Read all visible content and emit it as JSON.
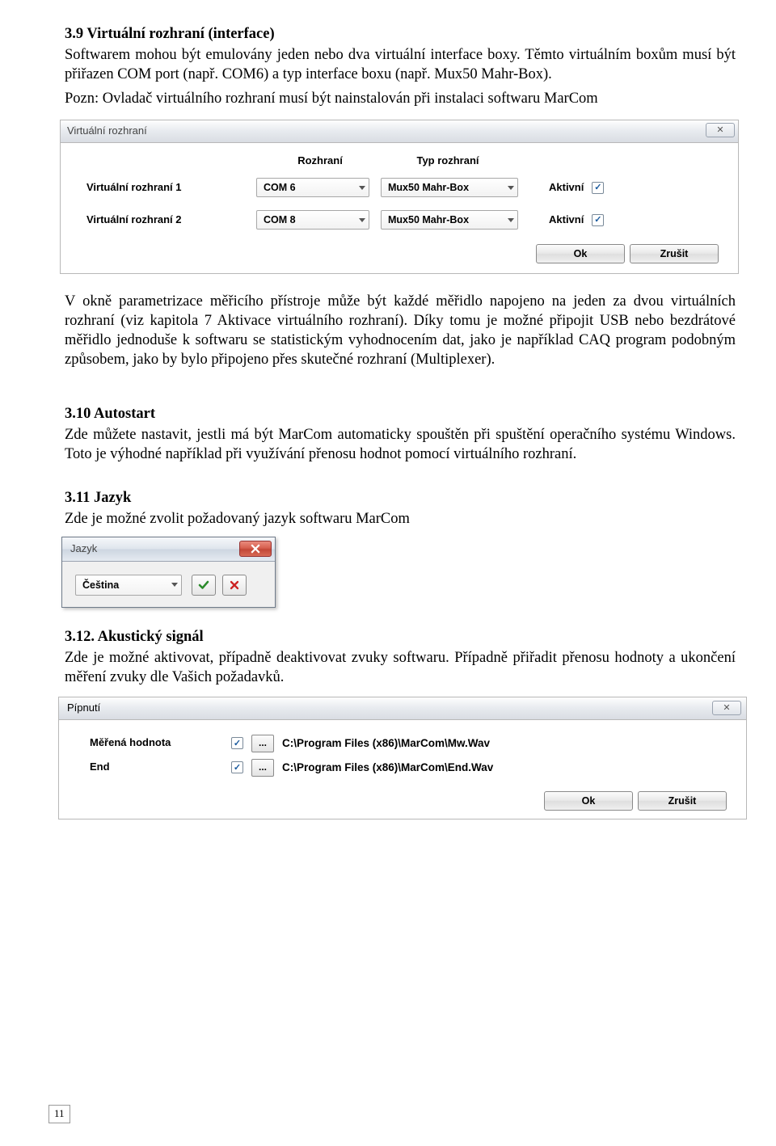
{
  "s39": {
    "heading": "3.9 Virtuální rozhraní (interface)",
    "p1": "Softwarem mohou být emulovány jeden nebo dva virtuální interface boxy. Těmto virtuálním boxům musí být přiřazen COM port (např. COM6) a typ interface boxu (např. Mux50 Mahr-Box).",
    "p2": "Pozn: Ovladač virtuálního rozhraní musí být nainstalován při instalaci softwaru MarCom",
    "p3": "V okně parametrizace měřicího přístroje může být každé měřidlo napojeno na jeden za dvou virtuálních rozhraní (viz kapitola 7 Aktivace virtuálního rozhraní). Díky tomu je možné připojit USB nebo bezdrátové měřidlo jednoduše k softwaru se statistickým vyhodnocením dat, jako je například CAQ program podobným způsobem, jako by bylo připojeno přes skutečné rozhraní (Multiplexer)."
  },
  "dlg1": {
    "title": "Virtuální rozhraní",
    "close": "✕",
    "col1": "Rozhraní",
    "col2": "Typ rozhraní",
    "row1_label": "Virtuální rozhraní 1",
    "row1_com": "COM 6",
    "row1_type": "Mux50 Mahr-Box",
    "row2_label": "Virtuální rozhraní 2",
    "row2_com": "COM 8",
    "row2_type": "Mux50 Mahr-Box",
    "active": "Aktivní",
    "check": "✓",
    "ok": "Ok",
    "cancel": "Zrušit"
  },
  "s310": {
    "heading": "3.10 Autostart",
    "p": "Zde můžete nastavit, jestli má být MarCom automaticky spouštěn při spuštění operačního systému Windows. Toto je výhodné například při využívání přenosu hodnot pomocí virtuálního rozhraní."
  },
  "s311": {
    "heading": "3.11 Jazyk",
    "p": "Zde je možné zvolit požadovaný jazyk softwaru MarCom"
  },
  "dlg2": {
    "title": "Jazyk",
    "value": "Čeština"
  },
  "s312": {
    "heading": "3.12. Akustický signál",
    "p": "Zde je možné aktivovat, případně deaktivovat zvuky softwaru. Případně přiřadit přenosu hodnoty a ukončení měření zvuky dle Vašich požadavků."
  },
  "dlg3": {
    "title": "Pípnutí",
    "close": "✕",
    "row1_label": "Měřená hodnota",
    "row1_check": "✓",
    "row1_dots": "...",
    "row1_path": "C:\\Program Files (x86)\\MarCom\\Mw.Wav",
    "row2_label": "End",
    "row2_check": "✓",
    "row2_dots": "...",
    "row2_path": "C:\\Program Files (x86)\\MarCom\\End.Wav",
    "ok": "Ok",
    "cancel": "Zrušit"
  },
  "page": "11"
}
